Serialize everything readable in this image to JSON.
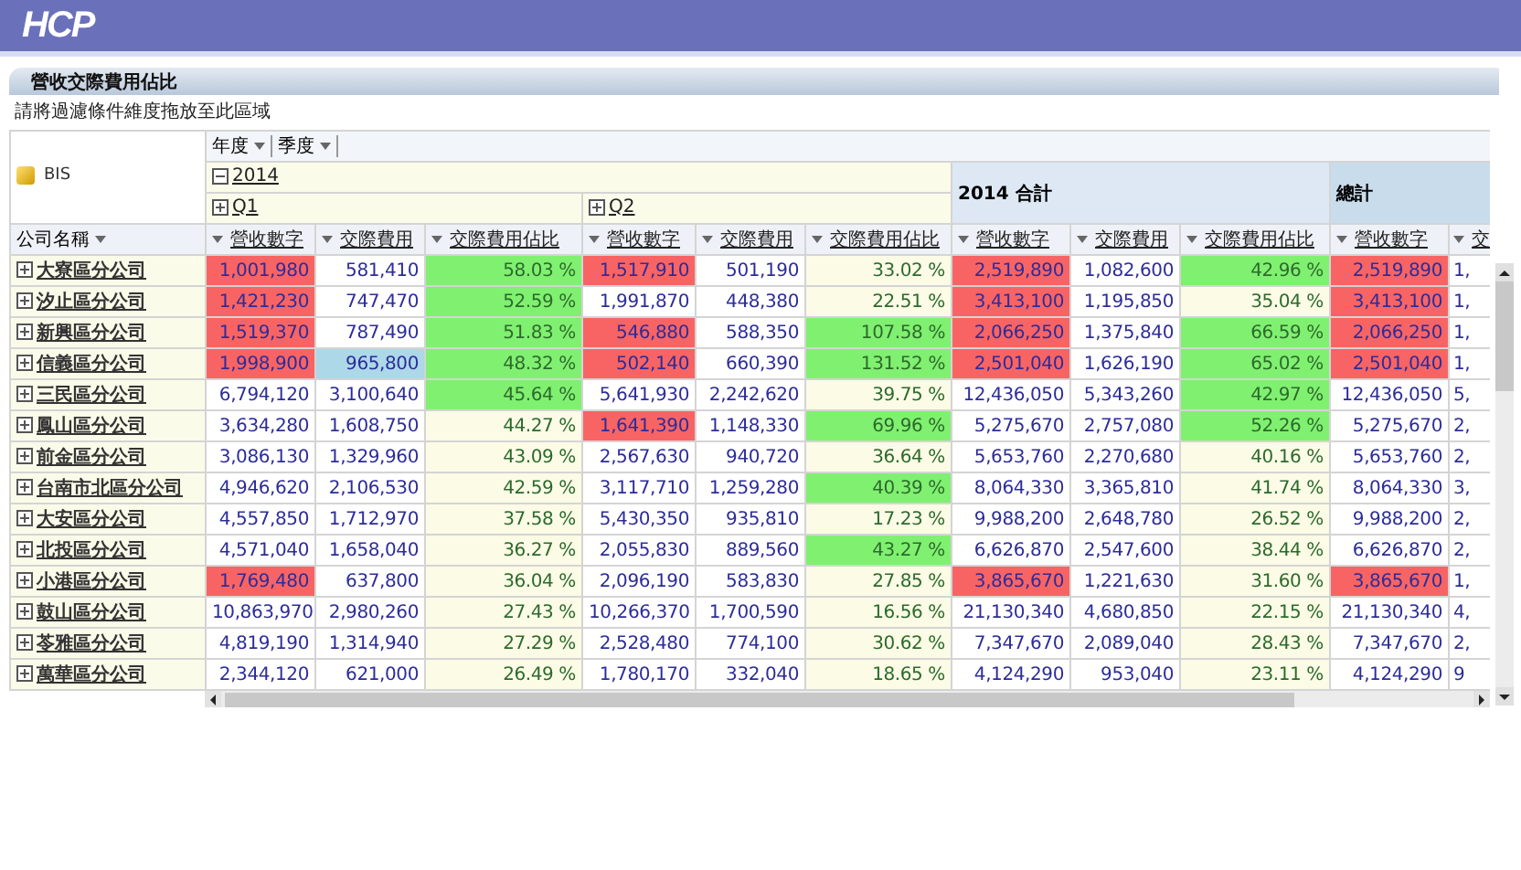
{
  "app": {
    "logo": "HCP"
  },
  "report": {
    "title": "營收交際費用佔比",
    "filter_hint": "請將過濾條件維度拖放至此區域"
  },
  "pivot": {
    "cube": "BIS",
    "column_dimensions": [
      "年度",
      "季度"
    ],
    "row_dimension": "公司名稱",
    "year": {
      "label": "2014",
      "expanded": true
    },
    "quarters": [
      {
        "label": "Q1",
        "expanded": false
      },
      {
        "label": "Q2",
        "expanded": false
      }
    ],
    "year_total": "2014 合計",
    "grand_total": "總計",
    "columns": [
      {
        "label": "營收數字",
        "kind": "amount"
      },
      {
        "label": "交際費用",
        "kind": "amount"
      },
      {
        "label": "交際費用佔比",
        "kind": "ratio"
      },
      {
        "label": "營收數字",
        "kind": "amount"
      },
      {
        "label": "交際費用",
        "kind": "amount"
      },
      {
        "label": "交際費用佔比",
        "kind": "ratio"
      },
      {
        "label": "營收數字",
        "kind": "amount"
      },
      {
        "label": "交際費用",
        "kind": "amount"
      },
      {
        "label": "交際費用佔比",
        "kind": "ratio"
      },
      {
        "label": "營收數字",
        "kind": "amount"
      },
      {
        "label": "交",
        "kind": "amount"
      }
    ],
    "rows": [
      {
        "company": "大寮區分公司",
        "expanded": false,
        "cells": [
          {
            "text": "1,001,980",
            "color": "#f86464"
          },
          {
            "text": "581,410"
          },
          {
            "text": "58.03 %",
            "color": "#80f070"
          },
          {
            "text": "1,517,910",
            "color": "#f86464"
          },
          {
            "text": "501,190"
          },
          {
            "text": "33.02 %"
          },
          {
            "text": "2,519,890",
            "color": "#f86464"
          },
          {
            "text": "1,082,600"
          },
          {
            "text": "42.96 %",
            "color": "#80f070"
          },
          {
            "text": "2,519,890",
            "color": "#f86464"
          },
          {
            "text": "1,"
          }
        ]
      },
      {
        "company": "汐止區分公司",
        "expanded": false,
        "cells": [
          {
            "text": "1,421,230",
            "color": "#f86464"
          },
          {
            "text": "747,470"
          },
          {
            "text": "52.59 %",
            "color": "#80f070"
          },
          {
            "text": "1,991,870"
          },
          {
            "text": "448,380"
          },
          {
            "text": "22.51 %"
          },
          {
            "text": "3,413,100",
            "color": "#f86464"
          },
          {
            "text": "1,195,850"
          },
          {
            "text": "35.04 %"
          },
          {
            "text": "3,413,100",
            "color": "#f86464"
          },
          {
            "text": "1,"
          }
        ]
      },
      {
        "company": "新興區分公司",
        "expanded": false,
        "cells": [
          {
            "text": "1,519,370",
            "color": "#f86464"
          },
          {
            "text": "787,490"
          },
          {
            "text": "51.83 %",
            "color": "#80f070"
          },
          {
            "text": "546,880",
            "color": "#f86464"
          },
          {
            "text": "588,350"
          },
          {
            "text": "107.58 %",
            "color": "#80f070"
          },
          {
            "text": "2,066,250",
            "color": "#f86464"
          },
          {
            "text": "1,375,840"
          },
          {
            "text": "66.59 %",
            "color": "#80f070"
          },
          {
            "text": "2,066,250",
            "color": "#f86464"
          },
          {
            "text": "1,"
          }
        ]
      },
      {
        "company": "信義區分公司",
        "expanded": false,
        "cells": [
          {
            "text": "1,998,900",
            "color": "#f86464"
          },
          {
            "text": "965,800",
            "color": "#acd8e8"
          },
          {
            "text": "48.32 %",
            "color": "#80f070"
          },
          {
            "text": "502,140",
            "color": "#f86464"
          },
          {
            "text": "660,390"
          },
          {
            "text": "131.52 %",
            "color": "#80f070"
          },
          {
            "text": "2,501,040",
            "color": "#f86464"
          },
          {
            "text": "1,626,190"
          },
          {
            "text": "65.02 %",
            "color": "#80f070"
          },
          {
            "text": "2,501,040",
            "color": "#f86464"
          },
          {
            "text": "1,"
          }
        ]
      },
      {
        "company": "三民區分公司",
        "expanded": false,
        "cells": [
          {
            "text": "6,794,120"
          },
          {
            "text": "3,100,640"
          },
          {
            "text": "45.64 %",
            "color": "#80f070"
          },
          {
            "text": "5,641,930"
          },
          {
            "text": "2,242,620"
          },
          {
            "text": "39.75 %"
          },
          {
            "text": "12,436,050"
          },
          {
            "text": "5,343,260"
          },
          {
            "text": "42.97 %",
            "color": "#80f070"
          },
          {
            "text": "12,436,050"
          },
          {
            "text": "5,"
          }
        ]
      },
      {
        "company": "鳳山區分公司",
        "expanded": false,
        "cells": [
          {
            "text": "3,634,280"
          },
          {
            "text": "1,608,750"
          },
          {
            "text": "44.27 %"
          },
          {
            "text": "1,641,390",
            "color": "#f86464"
          },
          {
            "text": "1,148,330"
          },
          {
            "text": "69.96 %",
            "color": "#80f070"
          },
          {
            "text": "5,275,670"
          },
          {
            "text": "2,757,080"
          },
          {
            "text": "52.26 %",
            "color": "#80f070"
          },
          {
            "text": "5,275,670"
          },
          {
            "text": "2,"
          }
        ]
      },
      {
        "company": "前金區分公司",
        "expanded": false,
        "cells": [
          {
            "text": "3,086,130"
          },
          {
            "text": "1,329,960"
          },
          {
            "text": "43.09 %"
          },
          {
            "text": "2,567,630"
          },
          {
            "text": "940,720"
          },
          {
            "text": "36.64 %"
          },
          {
            "text": "5,653,760"
          },
          {
            "text": "2,270,680"
          },
          {
            "text": "40.16 %"
          },
          {
            "text": "5,653,760"
          },
          {
            "text": "2,"
          }
        ]
      },
      {
        "company": "台南市北區分公司",
        "expanded": false,
        "cells": [
          {
            "text": "4,946,620"
          },
          {
            "text": "2,106,530"
          },
          {
            "text": "42.59 %"
          },
          {
            "text": "3,117,710"
          },
          {
            "text": "1,259,280"
          },
          {
            "text": "40.39 %",
            "color": "#80f070"
          },
          {
            "text": "8,064,330"
          },
          {
            "text": "3,365,810"
          },
          {
            "text": "41.74 %"
          },
          {
            "text": "8,064,330"
          },
          {
            "text": "3,"
          }
        ]
      },
      {
        "company": "大安區分公司",
        "expanded": false,
        "cells": [
          {
            "text": "4,557,850"
          },
          {
            "text": "1,712,970"
          },
          {
            "text": "37.58 %"
          },
          {
            "text": "5,430,350"
          },
          {
            "text": "935,810"
          },
          {
            "text": "17.23 %"
          },
          {
            "text": "9,988,200"
          },
          {
            "text": "2,648,780"
          },
          {
            "text": "26.52 %"
          },
          {
            "text": "9,988,200"
          },
          {
            "text": "2,"
          }
        ]
      },
      {
        "company": "北投區分公司",
        "expanded": false,
        "cells": [
          {
            "text": "4,571,040"
          },
          {
            "text": "1,658,040"
          },
          {
            "text": "36.27 %"
          },
          {
            "text": "2,055,830"
          },
          {
            "text": "889,560"
          },
          {
            "text": "43.27 %",
            "color": "#80f070"
          },
          {
            "text": "6,626,870"
          },
          {
            "text": "2,547,600"
          },
          {
            "text": "38.44 %"
          },
          {
            "text": "6,626,870"
          },
          {
            "text": "2,"
          }
        ]
      },
      {
        "company": "小港區分公司",
        "expanded": false,
        "cells": [
          {
            "text": "1,769,480",
            "color": "#f86464"
          },
          {
            "text": "637,800"
          },
          {
            "text": "36.04 %"
          },
          {
            "text": "2,096,190"
          },
          {
            "text": "583,830"
          },
          {
            "text": "27.85 %"
          },
          {
            "text": "3,865,670",
            "color": "#f86464"
          },
          {
            "text": "1,221,630"
          },
          {
            "text": "31.60 %"
          },
          {
            "text": "3,865,670",
            "color": "#f86464"
          },
          {
            "text": "1,"
          }
        ]
      },
      {
        "company": "鼓山區分公司",
        "expanded": false,
        "cells": [
          {
            "text": "10,863,970"
          },
          {
            "text": "2,980,260"
          },
          {
            "text": "27.43 %"
          },
          {
            "text": "10,266,370"
          },
          {
            "text": "1,700,590"
          },
          {
            "text": "16.56 %"
          },
          {
            "text": "21,130,340"
          },
          {
            "text": "4,680,850"
          },
          {
            "text": "22.15 %"
          },
          {
            "text": "21,130,340"
          },
          {
            "text": "4,"
          }
        ]
      },
      {
        "company": "苓雅區分公司",
        "expanded": false,
        "cells": [
          {
            "text": "4,819,190"
          },
          {
            "text": "1,314,940"
          },
          {
            "text": "27.29 %"
          },
          {
            "text": "2,528,480"
          },
          {
            "text": "774,100"
          },
          {
            "text": "30.62 %"
          },
          {
            "text": "7,347,670"
          },
          {
            "text": "2,089,040"
          },
          {
            "text": "28.43 %"
          },
          {
            "text": "7,347,670"
          },
          {
            "text": "2,"
          }
        ]
      },
      {
        "company": "萬華區分公司",
        "expanded": false,
        "cells": [
          {
            "text": "2,344,120"
          },
          {
            "text": "621,000"
          },
          {
            "text": "26.49 %"
          },
          {
            "text": "1,780,170"
          },
          {
            "text": "332,040"
          },
          {
            "text": "18.65 %"
          },
          {
            "text": "4,124,290"
          },
          {
            "text": "953,040"
          },
          {
            "text": "23.11 %"
          },
          {
            "text": "4,124,290"
          },
          {
            "text": "9"
          }
        ]
      }
    ]
  }
}
